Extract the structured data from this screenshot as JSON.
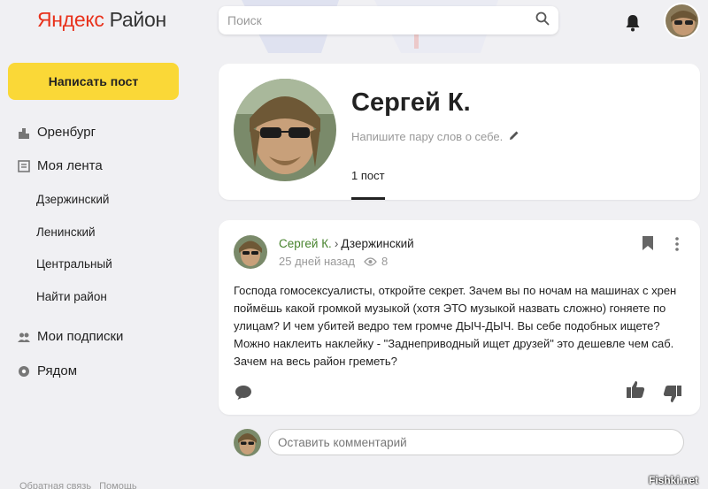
{
  "header": {
    "logo_brand": "Яндекс",
    "logo_product": "Район",
    "search_placeholder": "Поиск",
    "icons": [
      "search-icon",
      "bell-icon"
    ]
  },
  "sidebar": {
    "write_post_label": "Написать пост",
    "items": [
      {
        "label": "Оренбург",
        "icon": "city-icon"
      },
      {
        "label": "Моя лента",
        "icon": "feed-icon"
      },
      {
        "label": "Мои подписки",
        "icon": "people-icon"
      },
      {
        "label": "Рядом",
        "icon": "location-icon"
      }
    ],
    "districts": [
      "Дзержинский",
      "Ленинский",
      "Центральный",
      "Найти район"
    ],
    "footer": [
      "Обратная связь",
      "Помощь"
    ]
  },
  "profile": {
    "name": "Сергей К.",
    "bio_placeholder": "Напишите пару слов о себе.",
    "tab_label": "1 пост"
  },
  "post": {
    "author": "Сергей К.",
    "separator": "›",
    "district": "Дзержинский",
    "time": "25 дней назад",
    "views": "8",
    "text": "Господа гомосексуалисты, откройте секрет. Зачем вы по ночам на машинах с хрен поймёшь какой громкой музыкой (хотя ЭТО музыкой назвать сложно) гоняете по улицам? И чем убитей ведро тем громче ДЫЧ-ДЫЧ. Вы себе подобных ищете? Можно наклеить наклейку - \"Заднеприводный ищет друзей\" это дешевле чем саб. Зачем на весь район греметь?"
  },
  "comment": {
    "placeholder": "Оставить комментарий"
  },
  "watermark": "Fishki.net",
  "colors": {
    "accent_yellow": "#fad837",
    "brand_red": "#e8321c",
    "author_green": "#47832d",
    "background": "#f0f0f3"
  }
}
